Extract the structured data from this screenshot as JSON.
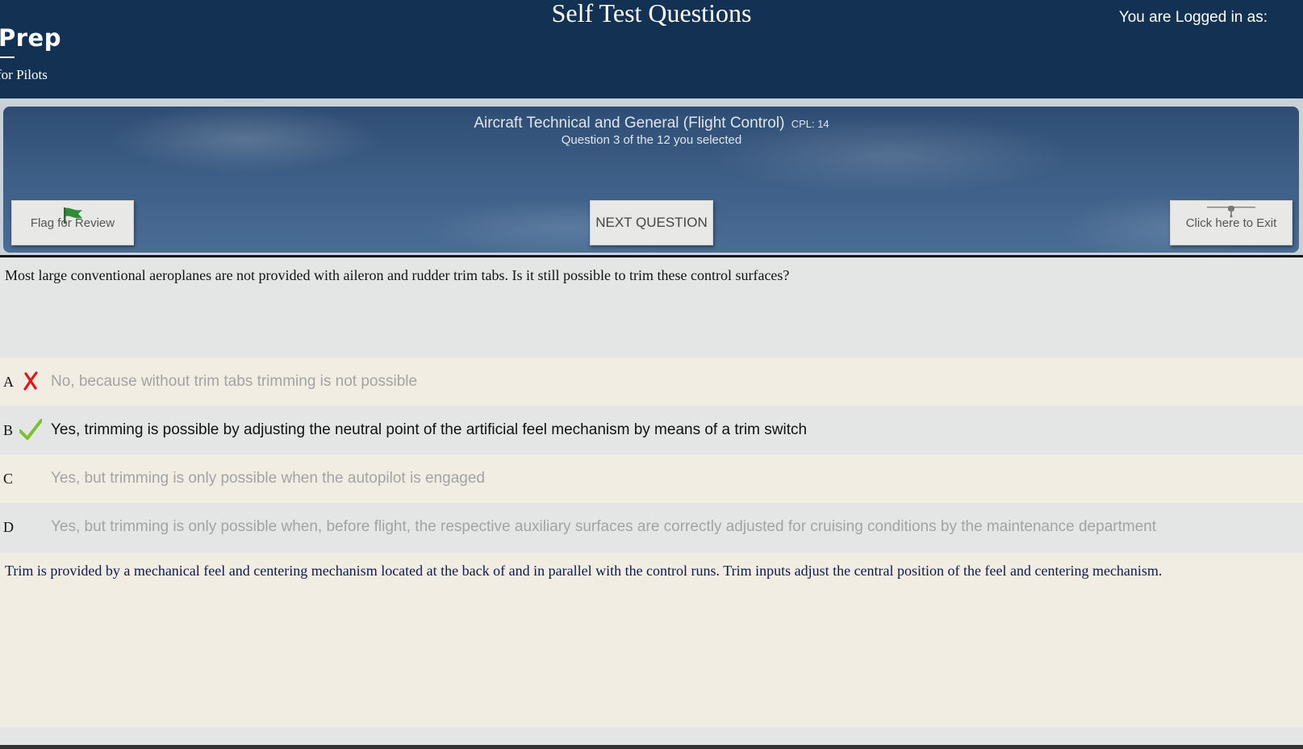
{
  "header": {
    "logo_main": "Prep",
    "logo_sub": "for Pilots",
    "page_title": "Self Test Questions",
    "login_text": "You are Logged in as:"
  },
  "banner": {
    "course_title": "Aircraft Technical and General (Flight Control)",
    "course_code": "CPL: 14",
    "question_count": "Question 3 of the 12 you selected"
  },
  "buttons": {
    "flag_label": "Flag for Review",
    "next_label": "NEXT QUESTION",
    "exit_label": "Click here to Exit"
  },
  "question": {
    "text": "Most large conventional aeroplanes are not provided with aileron and rudder trim tabs. Is it still possible to trim these control surfaces?"
  },
  "answers": [
    {
      "letter": "A",
      "text": "No, because without trim tabs trimming is not possible",
      "mark": "cross-icon"
    },
    {
      "letter": "B",
      "text": "Yes, trimming is possible by adjusting the neutral point of the artificial feel mechanism by means of a trim switch",
      "mark": "check-icon"
    },
    {
      "letter": "C",
      "text": "Yes, but trimming is only possible when the autopilot is engaged",
      "mark": ""
    },
    {
      "letter": "D",
      "text": "Yes, but trimming is only possible when, before flight, the respective auxiliary surfaces are correctly adjusted for cruising conditions by the maintenance department",
      "mark": ""
    }
  ],
  "explanation": {
    "text": "Trim is provided by a mechanical feel and centering mechanism located at the back of and in parallel with the control runs. Trim inputs adjust the central position of the feel and centering mechanism."
  },
  "colors": {
    "header_bg": "#133253",
    "wrong_mark": "#e8141c",
    "correct_mark": "#7cc22b",
    "flag_green": "#2e8b3a"
  }
}
